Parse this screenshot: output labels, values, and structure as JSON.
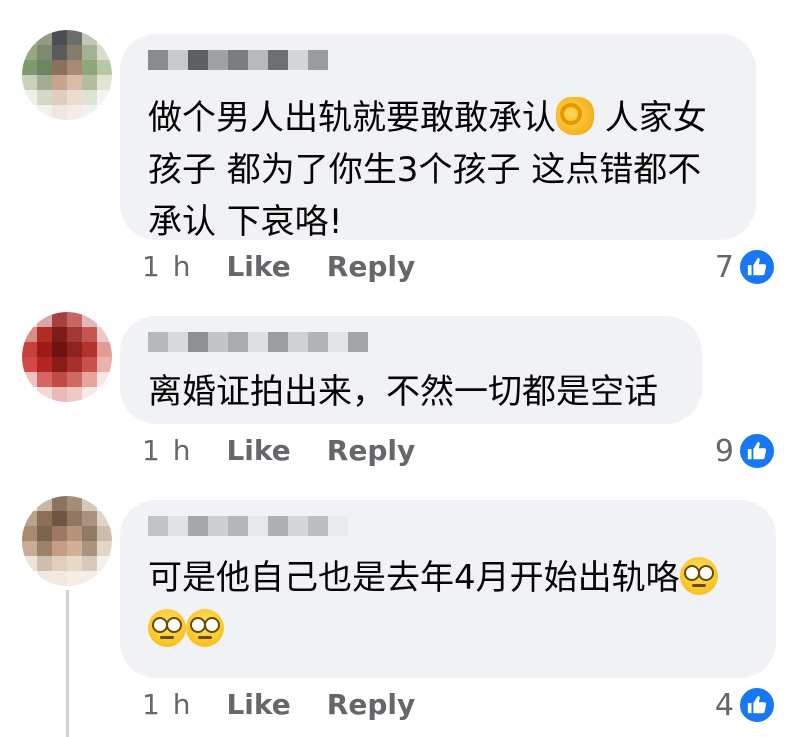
{
  "comments": [
    {
      "text_parts": [
        "做个男人出轨就要敢敢承认",
        "ok-hand-emoji",
        " 人家女\n孩子 都为了你生3个孩子 这点错都不\n承认 下哀咯!"
      ],
      "text_line1": "做个男人出轨就要敢敢承认",
      "text_rest": " 人家女\n孩子 都为了你生3个孩子 这点错都不\n承认 下哀咯!",
      "time": "1 h",
      "like_label": "Like",
      "reply_label": "Reply",
      "reaction_count": "7"
    },
    {
      "text": "离婚证拍出来，不然一切都是空话",
      "time": "1 h",
      "like_label": "Like",
      "reply_label": "Reply",
      "reaction_count": "9"
    },
    {
      "text": "可是他自己也是去年4月开始出轨咯",
      "emoji": "face-with-rolling-eyes",
      "time": "1 h",
      "like_label": "Like",
      "reply_label": "Reply",
      "reaction_count": "4"
    }
  ],
  "colors": {
    "bubble": "#f0f2f5",
    "meta_text": "#65676b",
    "like_badge": "#1877f2"
  },
  "icons": {
    "reaction": "thumbs-up-icon",
    "emoji_1": "ok-hand-emoji",
    "emoji_2": "rolling-eyes-emoji"
  }
}
